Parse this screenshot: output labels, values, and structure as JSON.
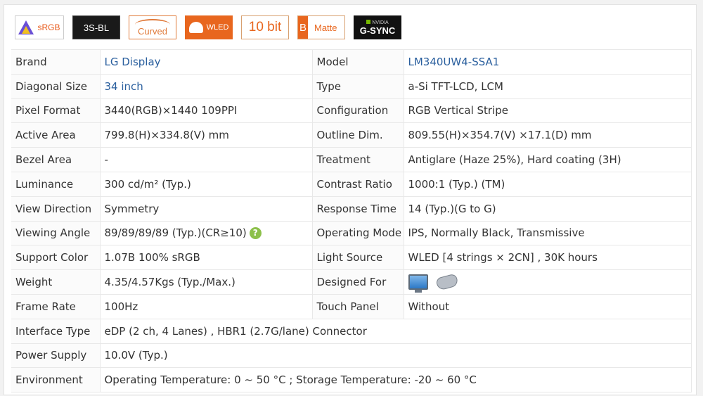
{
  "badges": {
    "srgb": "sRGB",
    "backlight": "3S-BL",
    "curved": "Curved",
    "wled": "WLED",
    "bitdepth": "10 bit",
    "matte_mark": "B",
    "matte": "Matte",
    "gsync_brand": "NVIDIA",
    "gsync": "G-SYNC"
  },
  "specs": {
    "brand": {
      "label": "Brand",
      "value": "LG Display"
    },
    "model": {
      "label": "Model",
      "value": "LM340UW4-SSA1"
    },
    "diagonal": {
      "label": "Diagonal Size",
      "value": "34 inch"
    },
    "type": {
      "label": "Type",
      "value": "a-Si TFT-LCD, LCM"
    },
    "pixel_format": {
      "label": "Pixel Format",
      "value": "3440(RGB)×1440  109PPI"
    },
    "configuration": {
      "label": "Configuration",
      "value": "RGB Vertical Stripe"
    },
    "active_area": {
      "label": "Active Area",
      "value": "799.8(H)×334.8(V) mm"
    },
    "outline": {
      "label": "Outline Dim.",
      "value": "809.55(H)×354.7(V) ×17.1(D) mm"
    },
    "bezel": {
      "label": "Bezel Area",
      "value": "-"
    },
    "treatment": {
      "label": "Treatment",
      "value": "Antiglare (Haze 25%), Hard coating (3H)"
    },
    "luminance": {
      "label": "Luminance",
      "value": "300 cd/m² (Typ.)"
    },
    "contrast": {
      "label": "Contrast Ratio",
      "value": "1000:1 (Typ.) (TM)"
    },
    "view_direction": {
      "label": "View Direction",
      "value": "Symmetry"
    },
    "response_time": {
      "label": "Response Time",
      "value": "14 (Typ.)(G to G)"
    },
    "viewing_angle": {
      "label": "Viewing Angle",
      "value": "89/89/89/89 (Typ.)(CR≥10)",
      "help": "?"
    },
    "operating_mode": {
      "label": "Operating Mode",
      "value": "IPS, Normally Black, Transmissive"
    },
    "support_color": {
      "label": "Support Color",
      "value": "1.07B   100% sRGB"
    },
    "light_source": {
      "label": "Light Source",
      "value": "WLED  [4 strings × 2CN] , 30K hours"
    },
    "weight": {
      "label": "Weight",
      "value": "4.35/4.57Kgs (Typ./Max.)"
    },
    "designed_for": {
      "label": "Designed For",
      "icons": [
        "monitor-icon",
        "gamepad-icon"
      ]
    },
    "frame_rate": {
      "label": "Frame Rate",
      "value": "100Hz"
    },
    "touch_panel": {
      "label": "Touch Panel",
      "value": "Without"
    },
    "interface": {
      "label": "Interface Type",
      "value": "eDP (2 ch, 4 Lanes) , HBR1 (2.7G/lane) Connector"
    },
    "power": {
      "label": "Power Supply",
      "value": "10.0V (Typ.)"
    },
    "environment": {
      "label": "Environment",
      "value": "Operating Temperature: 0 ~ 50 °C ; Storage Temperature: -20 ~ 60 °C"
    }
  },
  "colors": {
    "link": "#2a5f9e",
    "accent": "#e8661e",
    "help": "#8cc04a"
  }
}
